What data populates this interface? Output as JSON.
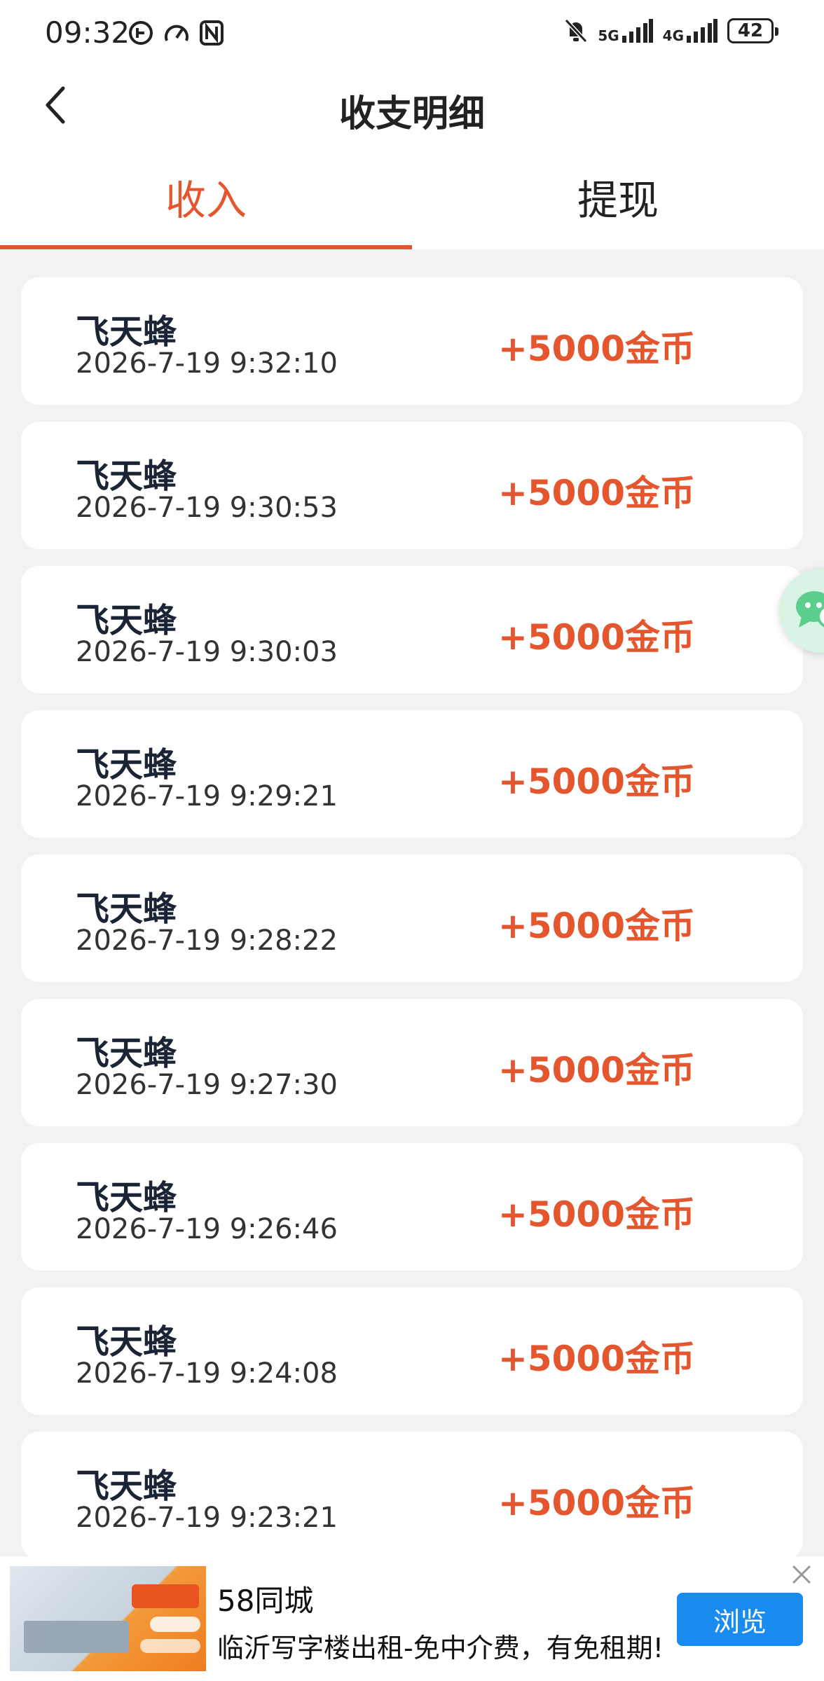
{
  "status_bar": {
    "time": "09:32",
    "network_1": "5G",
    "network_2": "4G",
    "battery": "42"
  },
  "header": {
    "title": "收支明细"
  },
  "tabs": [
    {
      "label": "收入",
      "active": true
    },
    {
      "label": "提现",
      "active": false
    }
  ],
  "records": [
    {
      "name": "飞天蜂",
      "time": "2026-7-19 9:32:10",
      "amount": "+5000金币"
    },
    {
      "name": "飞天蜂",
      "time": "2026-7-19 9:30:53",
      "amount": "+5000金币"
    },
    {
      "name": "飞天蜂",
      "time": "2026-7-19 9:30:03",
      "amount": "+5000金币"
    },
    {
      "name": "飞天蜂",
      "time": "2026-7-19 9:29:21",
      "amount": "+5000金币"
    },
    {
      "name": "飞天蜂",
      "time": "2026-7-19 9:28:22",
      "amount": "+5000金币"
    },
    {
      "name": "飞天蜂",
      "time": "2026-7-19 9:27:30",
      "amount": "+5000金币"
    },
    {
      "name": "飞天蜂",
      "time": "2026-7-19 9:26:46",
      "amount": "+5000金币"
    },
    {
      "name": "飞天蜂",
      "time": "2026-7-19 9:24:08",
      "amount": "+5000金币"
    },
    {
      "name": "飞天蜂",
      "time": "2026-7-19 9:23:21",
      "amount": "+5000金币"
    }
  ],
  "ad": {
    "brand": "58同城",
    "description": "临沂写字楼出租-免中介费，有免租期!",
    "button_label": "浏览"
  },
  "colors": {
    "accent": "#e4572e",
    "ad_button": "#1a8cf0",
    "background": "#f2f2f2"
  }
}
